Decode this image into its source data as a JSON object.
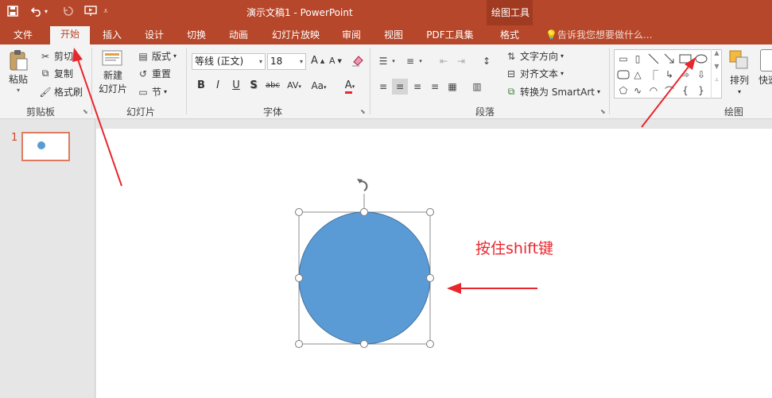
{
  "titlebar": {
    "doc_title": "演示文稿1 - PowerPoint",
    "context_group": "绘图工具"
  },
  "tabs": [
    {
      "label": "文件"
    },
    {
      "label": "开始"
    },
    {
      "label": "插入"
    },
    {
      "label": "设计"
    },
    {
      "label": "切换"
    },
    {
      "label": "动画"
    },
    {
      "label": "幻灯片放映"
    },
    {
      "label": "审阅"
    },
    {
      "label": "视图"
    },
    {
      "label": "PDF工具集"
    },
    {
      "label": "格式"
    }
  ],
  "tell_me": "告诉我您想要做什么...",
  "ribbon": {
    "clipboard": {
      "paste": "粘贴",
      "cut": "剪切",
      "copy": "复制",
      "format_painter": "格式刷",
      "group": "剪贴板"
    },
    "slides": {
      "new_slide_1": "新建",
      "new_slide_2": "幻灯片",
      "layout": "版式",
      "reset": "重置",
      "section": "节",
      "group": "幻灯片"
    },
    "font": {
      "font_name": "等线 (正文)",
      "font_size": "18",
      "group": "字体",
      "bold": "B",
      "italic": "I",
      "underline": "U",
      "shadow": "S",
      "strike": "abc",
      "spacing": "AV",
      "case": "Aa",
      "color": "A",
      "grow": "A",
      "shrink": "A"
    },
    "paragraph": {
      "text_direction": "文字方向",
      "align_text": "对齐文本",
      "smartart": "转换为 SmartArt",
      "group": "段落"
    },
    "drawing": {
      "arrange": "排列",
      "quick_styles": "快速",
      "group": "绘图"
    }
  },
  "slides_panel": {
    "slide_number": "1"
  },
  "annotation": {
    "text": "按住shift键"
  },
  "colors": {
    "accent": "#b7472a",
    "shape_fill": "#5b9bd5",
    "arrow": "#e8272d"
  }
}
